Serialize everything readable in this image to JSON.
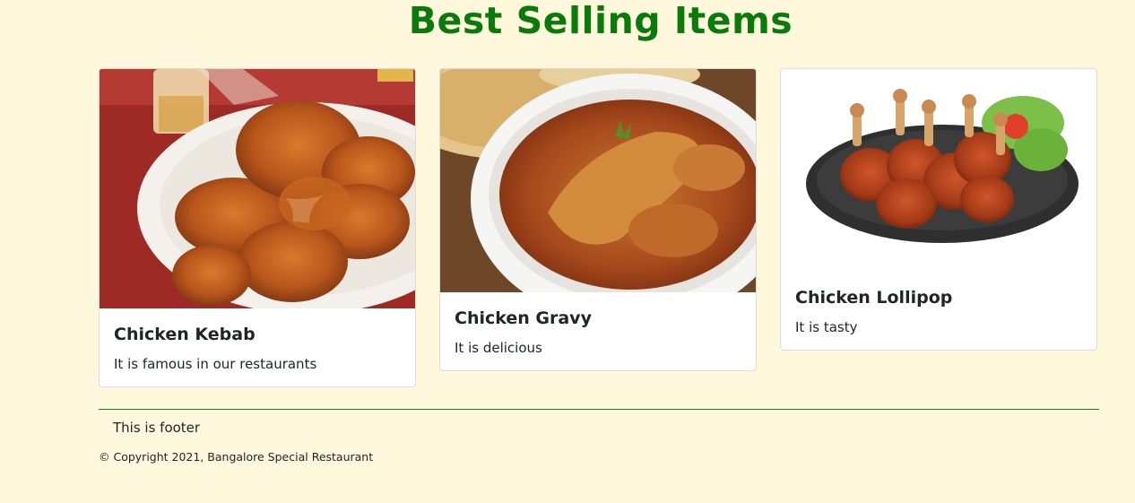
{
  "title": "Best Selling Items",
  "cards": [
    {
      "name": "Chicken Kebab",
      "text": "It is famous in our restaurants",
      "image": "fried-chicken-platter"
    },
    {
      "name": "Chicken Gravy",
      "text": "It is delicious",
      "image": "chicken-curry-bowl"
    },
    {
      "name": "Chicken Lollipop",
      "text": "It is tasty",
      "image": "chicken-lollipop-plate"
    }
  ],
  "footer": {
    "text": "This is footer",
    "copyright": "© Copyright 2021, Bangalore Special Restaurant"
  },
  "colors": {
    "background": "#fff8dc",
    "title": "#0a7a0a",
    "footer_line": "#1f7a1f"
  }
}
